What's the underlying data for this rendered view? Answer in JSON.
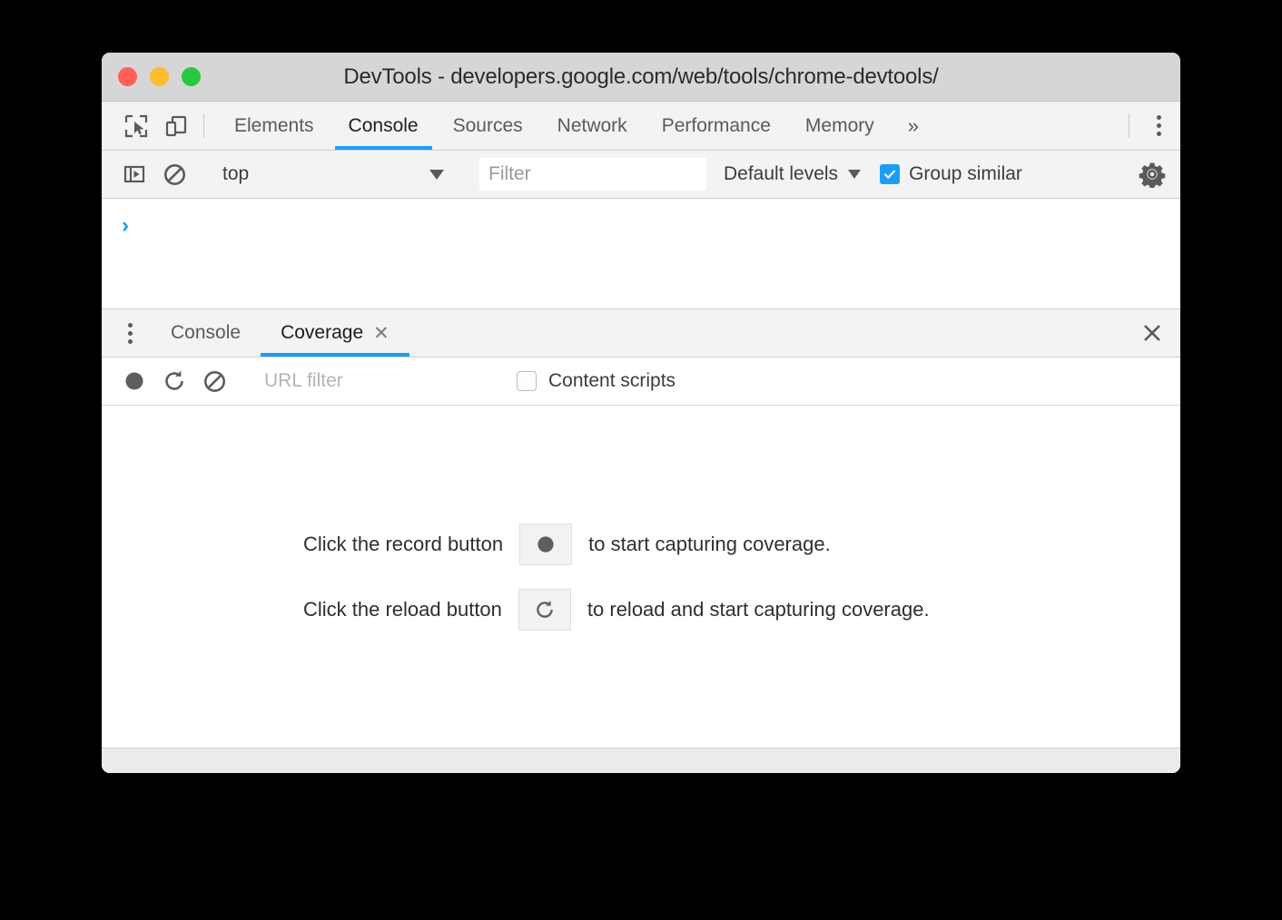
{
  "window": {
    "title": "DevTools - developers.google.com/web/tools/chrome-devtools/",
    "traffic_lights": [
      {
        "name": "close",
        "color": "#ff5f56"
      },
      {
        "name": "minimize",
        "color": "#febc2e"
      },
      {
        "name": "zoom",
        "color": "#28c840"
      }
    ]
  },
  "main_toolbar": {
    "inspect_icon": "inspect-element-icon",
    "device_icon": "device-toolbar-icon",
    "more_tabs_label": "»",
    "tabs": [
      {
        "label": "Elements",
        "active": false
      },
      {
        "label": "Console",
        "active": true
      },
      {
        "label": "Sources",
        "active": false
      },
      {
        "label": "Network",
        "active": false
      },
      {
        "label": "Performance",
        "active": false
      },
      {
        "label": "Memory",
        "active": false
      }
    ],
    "main_menu_icon": "kebab-menu-icon"
  },
  "console_toolbar": {
    "sidebar_toggle_icon": "console-sidebar-toggle-icon",
    "clear_icon": "clear-console-icon",
    "context": {
      "value": "top"
    },
    "filter": {
      "placeholder": "Filter",
      "value": ""
    },
    "levels": {
      "label": "Default levels"
    },
    "group_similar": {
      "label": "Group similar",
      "checked": true
    },
    "settings_icon": "gear-icon"
  },
  "console_output": {
    "prompt": "›"
  },
  "drawer": {
    "menu_icon": "kebab-menu-icon",
    "tabs": [
      {
        "label": "Console",
        "active": false,
        "closable": false
      },
      {
        "label": "Coverage",
        "active": true,
        "closable": true,
        "close_glyph": "✕"
      }
    ],
    "close_glyph": "✕",
    "coverage_toolbar": {
      "record_icon": "record-icon",
      "reload_icon": "reload-icon",
      "clear_icon": "clear-icon",
      "url_filter": {
        "placeholder": "URL filter",
        "value": ""
      },
      "content_scripts": {
        "label": "Content scripts",
        "checked": false
      }
    },
    "coverage_hints": [
      {
        "text_before": "Click the record button",
        "button_icon": "record-icon",
        "text_after": "to start capturing coverage."
      },
      {
        "text_before": "Click the reload button",
        "button_icon": "reload-icon",
        "text_after": "to reload and start capturing coverage."
      }
    ]
  },
  "colors": {
    "accent": "#1a9ef4",
    "titlebar": "#d6d6d6",
    "toolbar": "#f3f3f3",
    "icon": "#5a5a5a"
  }
}
